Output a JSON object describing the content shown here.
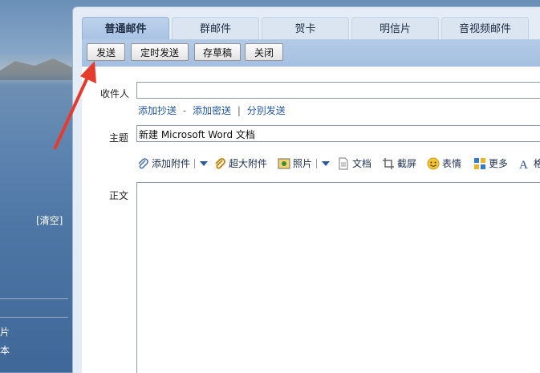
{
  "background": {
    "clear_label": "[清空]",
    "edge_text_1": "片",
    "edge_text_2": "本"
  },
  "tabs": [
    {
      "label": "普通邮件",
      "active": true
    },
    {
      "label": "群邮件",
      "active": false
    },
    {
      "label": "贺卡",
      "active": false
    },
    {
      "label": "明信片",
      "active": false
    },
    {
      "label": "音视频邮件",
      "active": false
    }
  ],
  "toolbar": {
    "send": "发送",
    "schedule": "定时发送",
    "draft": "存草稿",
    "close": "关闭"
  },
  "compose": {
    "recipient_label": "收件人",
    "recipient_value": "",
    "add_cc": "添加抄送",
    "dash": "-",
    "add_bcc": "添加密送",
    "pipe": "|",
    "separate_send": "分别发送",
    "subject_label": "主题",
    "subject_value": "新建 Microsoft Word 文档",
    "body_label": "正文",
    "body_value": ""
  },
  "attach_toolbar": {
    "add_attachment": "添加附件",
    "large_attachment": "超大附件",
    "photo": "照片",
    "document": "文档",
    "screenshot": "截屏",
    "emoji": "表情",
    "more": "更多",
    "format": "格"
  },
  "colors": {
    "accent": "#1f56a3",
    "annotation_arrow": "#e53b2c"
  }
}
